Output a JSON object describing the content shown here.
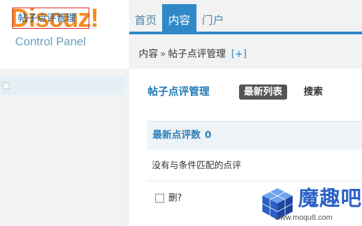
{
  "logo": {
    "title": "Discuz!",
    "subtitle": "Control Panel"
  },
  "nav": {
    "tabs": [
      {
        "label": "首页",
        "active": false
      },
      {
        "label": "内容",
        "active": true
      },
      {
        "label": "门户",
        "active": false
      }
    ]
  },
  "breadcrumb": {
    "root": "内容",
    "separator": "»",
    "current": "帖子点评管理",
    "add_label": "[+]"
  },
  "sidebar": {
    "items": [
      {
        "label": "帖子点评管理",
        "selected": true
      }
    ]
  },
  "main": {
    "title": "帖子点评管理",
    "buttons": {
      "latest": "最新列表",
      "search": "搜索"
    },
    "list_header": {
      "label": "最新点评数",
      "count": "0"
    },
    "empty_message": "没有与条件匹配的点评",
    "delete_label": "删?"
  },
  "watermark": {
    "text": "魔趣吧",
    "url": "www.moqu8.com"
  },
  "colors": {
    "accent": "#2f89c8",
    "logo_orange": "#f58b1f",
    "selection_border": "#d52424"
  }
}
